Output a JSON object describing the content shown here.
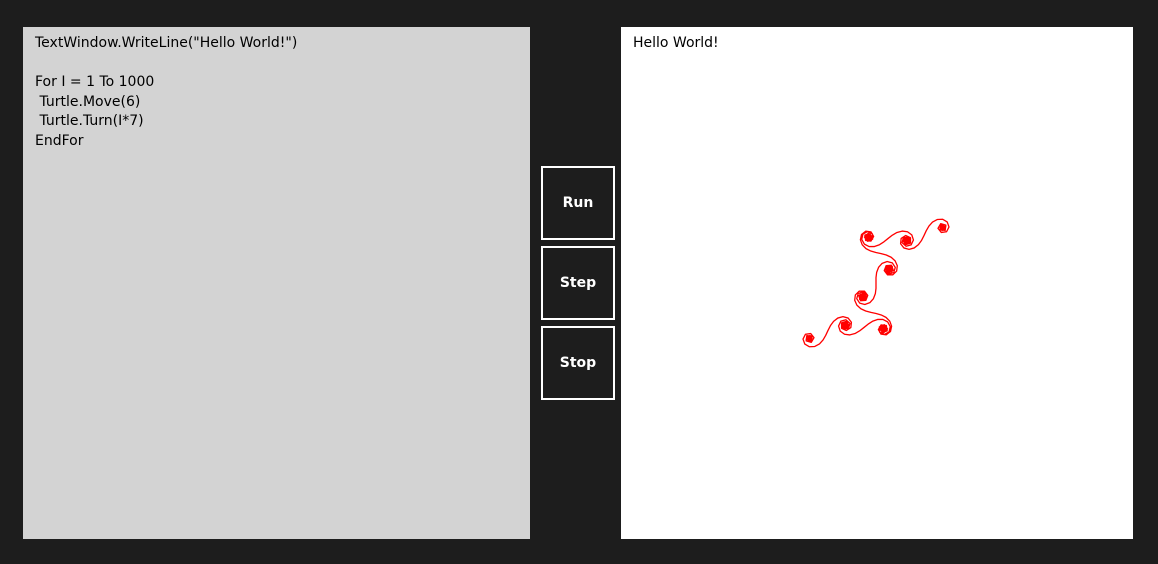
{
  "editor": {
    "code_lines": [
      "TextWindow.WriteLine(\"Hello World!\")",
      "",
      "For I = 1 To 1000",
      " Turtle.Move(6)",
      " Turtle.Turn(I*7)",
      "EndFor"
    ]
  },
  "controls": {
    "run_label": "Run",
    "step_label": "Step",
    "stop_label": "Stop"
  },
  "output": {
    "text": "Hello World!",
    "pen_color": "#ff0000"
  },
  "colors": {
    "app_background": "#1d1d1d",
    "editor_background": "#d3d3d3",
    "output_background": "#ffffff",
    "button_border": "#ffffff",
    "button_text": "#ffffff"
  }
}
